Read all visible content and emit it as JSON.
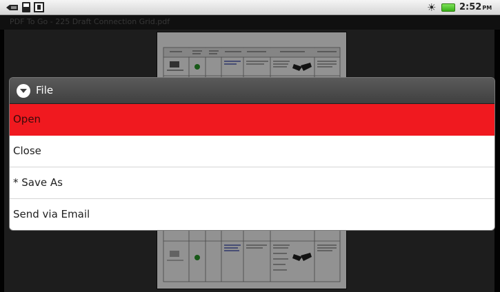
{
  "status_bar": {
    "icons": [
      "usb-debugging-icon",
      "sd-card-icon",
      "device-icon"
    ],
    "sun_glyph": "☀",
    "time": "2:52",
    "ampm": "PM"
  },
  "app": {
    "title": "PDF To Go - 225 Draft Connection Grid.pdf"
  },
  "dialog": {
    "title": "File",
    "icon": "menu-expand-icon",
    "items": [
      {
        "label": "Open",
        "selected": true
      },
      {
        "label": "Close",
        "selected": false
      },
      {
        "label": "* Save As",
        "selected": false
      },
      {
        "label": "Send via Email",
        "selected": false
      }
    ]
  },
  "colors": {
    "selected_item": "#f0191f",
    "dialog_header": "#4a4a4a",
    "battery": "#38b018"
  }
}
